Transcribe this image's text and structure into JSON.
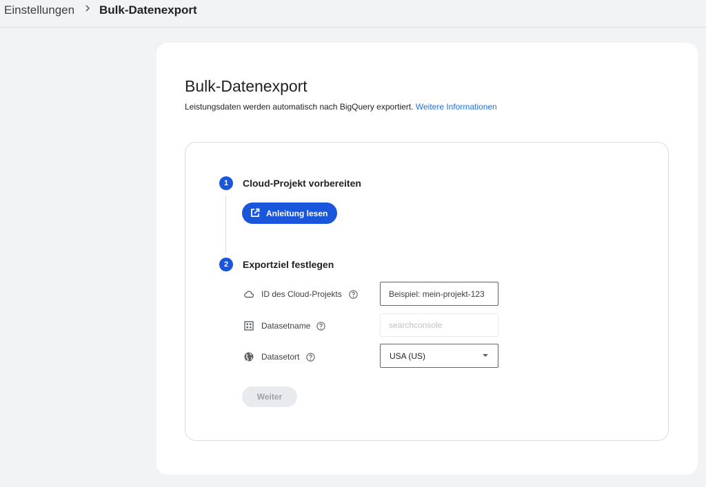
{
  "breadcrumb": {
    "parent": "Einstellungen",
    "current": "Bulk-Datenexport"
  },
  "page": {
    "title": "Bulk-Datenexport",
    "description": "Leistungsdaten werden automatisch nach BigQuery exportiert.",
    "learn_more": "Weitere Informationen"
  },
  "steps": [
    {
      "number": "1",
      "title": "Cloud-Projekt vorbereiten",
      "button_label": "Anleitung lesen"
    },
    {
      "number": "2",
      "title": "Exportziel festlegen"
    }
  ],
  "fields": {
    "project_id": {
      "label": "ID des Cloud-Projekts",
      "icon": "cloud-icon",
      "placeholder": "Beispiel: mein-projekt-123"
    },
    "dataset_name": {
      "label": "Datasetname",
      "icon": "dataset-icon",
      "placeholder": "searchconsole"
    },
    "dataset_location": {
      "label": "Datasetort",
      "icon": "globe-icon",
      "value": "USA (US)"
    }
  },
  "next_button": "Weiter",
  "colors": {
    "primary": "#1a56db",
    "link": "#1a73e8",
    "disabled_bg": "#e8eaed"
  }
}
